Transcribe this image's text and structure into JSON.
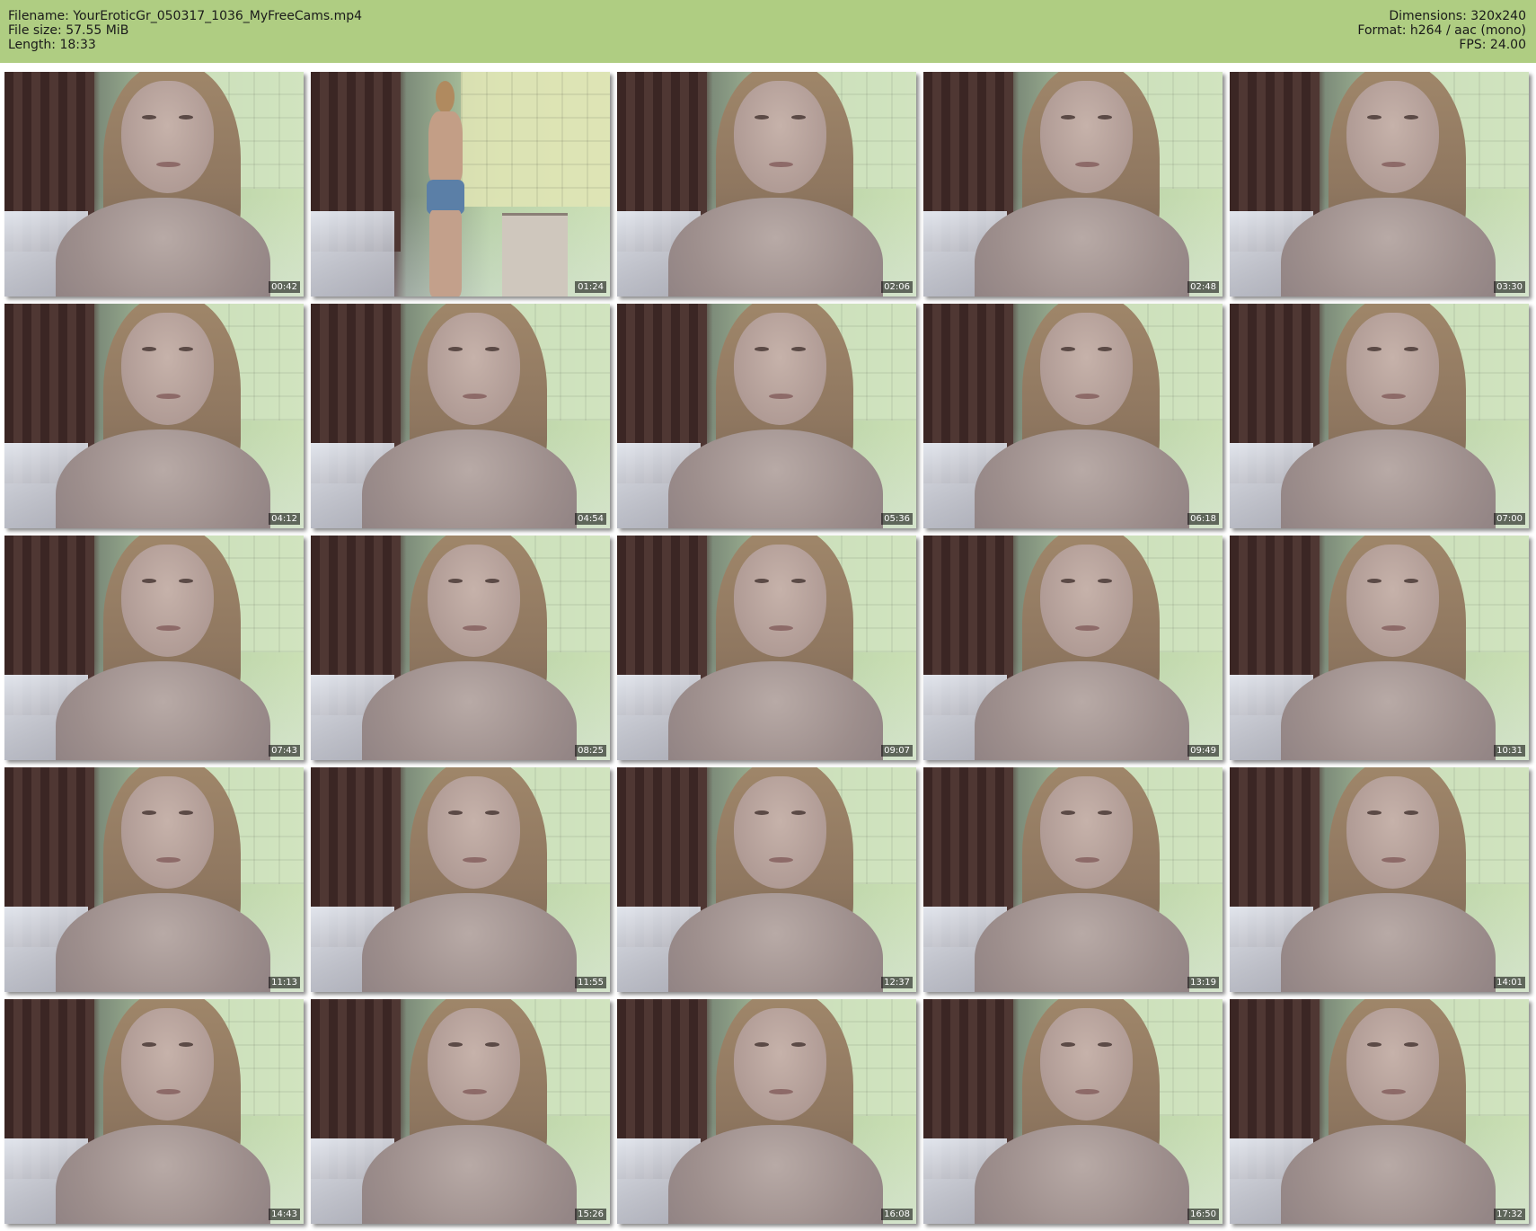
{
  "header": {
    "filename_label": "Filename:",
    "filename": "YourEroticGr_050317_1036_MyFreeCams.mp4",
    "filesize_label": "File size:",
    "filesize": "57.55 MiB",
    "length_label": "Length:",
    "length": "18:33",
    "dimensions_label": "Dimensions:",
    "dimensions": "320x240",
    "format_label": "Format:",
    "format": "h264 / aac (mono)",
    "fps_label": "FPS:",
    "fps": "24.00"
  },
  "thumbnails": [
    {
      "time": "00:42"
    },
    {
      "time": "01:24"
    },
    {
      "time": "02:06"
    },
    {
      "time": "02:48"
    },
    {
      "time": "03:30"
    },
    {
      "time": "04:12"
    },
    {
      "time": "04:54"
    },
    {
      "time": "05:36"
    },
    {
      "time": "06:18"
    },
    {
      "time": "07:00"
    },
    {
      "time": "07:43"
    },
    {
      "time": "08:25"
    },
    {
      "time": "09:07"
    },
    {
      "time": "09:49"
    },
    {
      "time": "10:31"
    },
    {
      "time": "11:13"
    },
    {
      "time": "11:55"
    },
    {
      "time": "12:37"
    },
    {
      "time": "13:19"
    },
    {
      "time": "14:01"
    },
    {
      "time": "14:43"
    },
    {
      "time": "15:26"
    },
    {
      "time": "16:08"
    },
    {
      "time": "16:50"
    },
    {
      "time": "17:32"
    }
  ],
  "colors": {
    "header_bg": "#afcd82",
    "page_bg": "#ffffff"
  }
}
